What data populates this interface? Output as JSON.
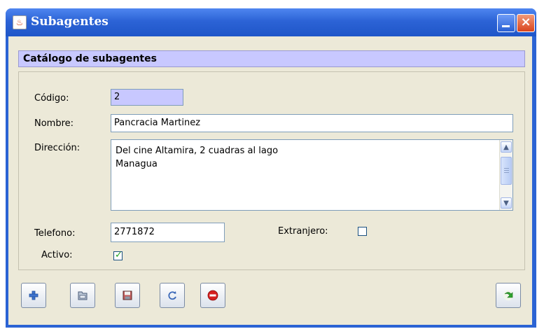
{
  "window": {
    "title": "Subagentes",
    "icon": "java-cup-icon"
  },
  "header": {
    "title": "Catálogo de subagentes"
  },
  "form": {
    "codigo": {
      "label": "Código:",
      "value": "2"
    },
    "nombre": {
      "label": "Nombre:",
      "value": "Pancracia Martinez"
    },
    "direccion": {
      "label": "Dirección:",
      "lines": [
        "Del cine Altamira, 2 cuadras al lago",
        "Managua"
      ]
    },
    "telefono": {
      "label": "Telefono:",
      "value": "2771872"
    },
    "extranjero": {
      "label": "Extranjero:",
      "checked": false
    },
    "activo": {
      "label": "Activo:",
      "checked": true
    }
  },
  "toolbar": {
    "buttons": [
      {
        "name": "add-button",
        "icon": "plus-icon"
      },
      {
        "name": "open-button",
        "icon": "folder-icon"
      },
      {
        "name": "save-button",
        "icon": "floppy-disk-icon"
      },
      {
        "name": "refresh-button",
        "icon": "refresh-icon"
      },
      {
        "name": "delete-button",
        "icon": "minus-circle-icon"
      },
      {
        "name": "exit-button",
        "icon": "green-arrow-icon"
      }
    ]
  },
  "colors": {
    "titlebar": "#2b63d4",
    "header_bg": "#c8c8ff",
    "panel_bg": "#ece9d8",
    "code_field_bg": "#c8c8ff"
  }
}
